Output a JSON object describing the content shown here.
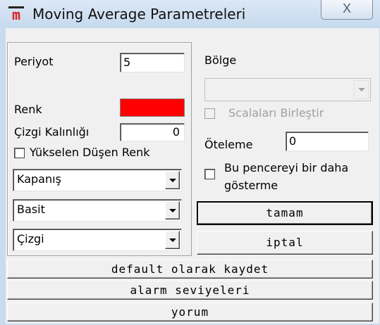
{
  "window": {
    "title": "Moving Average Parametreleri",
    "close_glyph": "X",
    "icon_glyph": "m"
  },
  "left": {
    "periyot_label": "Periyot",
    "periyot_value": "5",
    "renk_label": "Renk",
    "renk_color": "#ff0000",
    "cizgi_kalinligi_label": "Çizgi Kalınlığı",
    "cizgi_kalinligi_value": "0",
    "yukselen_dusen_label": "Yükselen Düşen Renk",
    "combo_price": "Kapanış",
    "combo_type": "Basit",
    "combo_style": "Çizgi"
  },
  "right": {
    "bolge_label": "Bölge",
    "bolge_value": "",
    "scala_label": "Scalaları Birleştir",
    "oteleme_label": "Öteleme",
    "oteleme_value": "0",
    "dont_show_label_1": "Bu pencereyi bir daha",
    "dont_show_label_2": "gösterme"
  },
  "buttons": {
    "tamam": "tamam",
    "iptal": "iptal",
    "default": "default olarak kaydet",
    "alarm": "alarm seviyeleri",
    "yorum": "yorum"
  }
}
